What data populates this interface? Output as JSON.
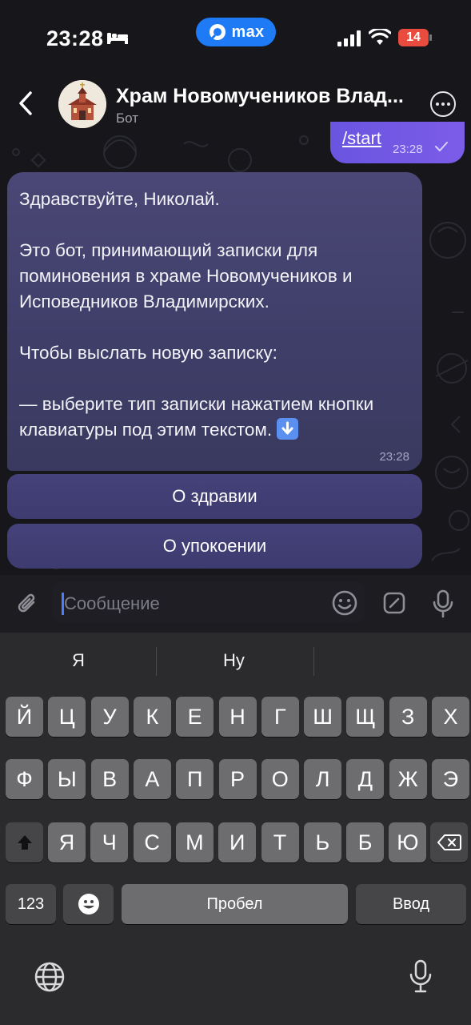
{
  "status_bar": {
    "time": "23:28",
    "app_pill_label": "max",
    "battery": "14",
    "icons": [
      "bed-icon",
      "signal-icon",
      "wifi-icon",
      "battery-icon"
    ]
  },
  "header": {
    "title": "Храм Новомучеников Влад...",
    "subtitle": "Бот",
    "icons": [
      "back-icon",
      "avatar",
      "more-icon"
    ]
  },
  "messages": {
    "outgoing": {
      "text": "/start",
      "time": "23:28"
    },
    "incoming": {
      "greeting": "Здравствуйте, Николай.",
      "about": "Это бот, принимающий записки для поминовения в храме Новомучеников и Исповедников Владимирских.",
      "prompt": "Чтобы выслать новую записку:",
      "instruction": "— выберите тип записки нажатием кнопки клавиатуры под этим текстом.",
      "emoji": "down-arrow-icon",
      "time": "23:28"
    }
  },
  "inline_keyboard": {
    "buttons": [
      "О здравии",
      "О упокоении"
    ]
  },
  "composer": {
    "placeholder": "Сообщение",
    "value": "",
    "icons": [
      "paperclip-icon",
      "emoji-icon",
      "sticker-icon",
      "microphone-icon"
    ]
  },
  "keyboard": {
    "suggestions": [
      "Я",
      "Ну"
    ],
    "row1": [
      "Й",
      "Ц",
      "У",
      "К",
      "Е",
      "Н",
      "Г",
      "Ш",
      "Щ",
      "З",
      "Х"
    ],
    "row2": [
      "Ф",
      "Ы",
      "В",
      "А",
      "П",
      "Р",
      "О",
      "Л",
      "Д",
      "Ж",
      "Э"
    ],
    "row3": [
      "Я",
      "Ч",
      "С",
      "М",
      "И",
      "Т",
      "Ь",
      "Б",
      "Ю"
    ],
    "numbers_key": "123",
    "space_key": "Пробел",
    "return_key": "Ввод",
    "icons": [
      "shift-icon",
      "backspace-icon",
      "emoji-key-icon",
      "globe-icon",
      "dictation-mic-icon"
    ]
  },
  "colors": {
    "accent": "#1e7bf5",
    "outgoing_bubble": "#6a55e0",
    "incoming_bubble": "#44426f",
    "battery_low": "#ea4b3f"
  }
}
